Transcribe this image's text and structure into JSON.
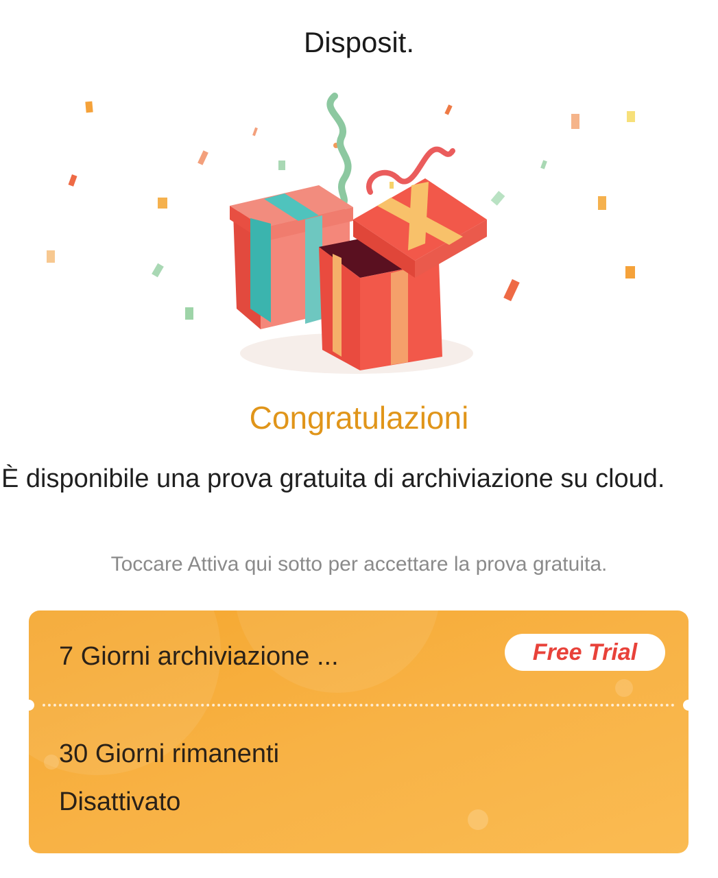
{
  "header": {
    "title": "Disposit."
  },
  "illustration": {
    "icon": "gift-boxes-confetti-icon"
  },
  "congrats": {
    "title": "Congratulazioni"
  },
  "message": {
    "text": "È disponibile una prova gratuita di archiviazione su cloud."
  },
  "instructions": {
    "text": "Toccare Attiva qui sotto per accettare la prova gratuita."
  },
  "plan_card": {
    "name": "7 Giorni archiviazione ...",
    "badge": "Free Trial",
    "days_remaining": "30 Giorni rimanenti",
    "status": "Disattivato",
    "accent_color": "#f7ad3a",
    "badge_text_color": "#e8423a"
  }
}
